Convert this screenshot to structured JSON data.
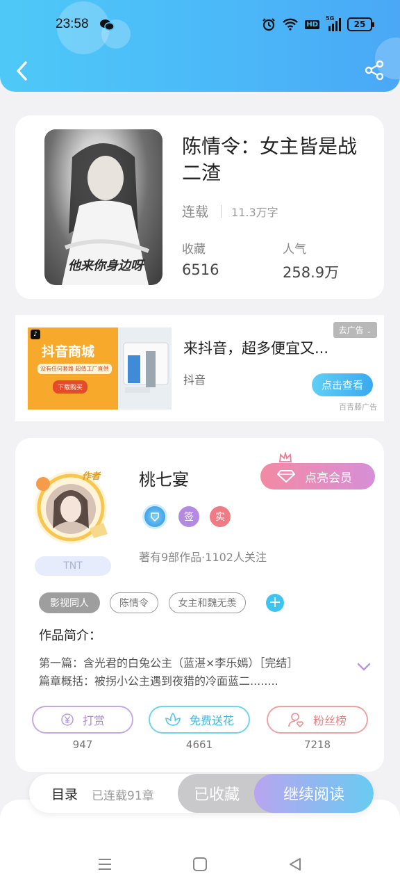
{
  "status_bar": {
    "time": "23:58",
    "network": "5G",
    "hd": "HD",
    "battery": "25"
  },
  "book": {
    "title": "陈情令：女主皆是战二渣",
    "status": "连载",
    "words": "11.3万字",
    "favorites_label": "收藏",
    "favorites_value": "6516",
    "popularity_label": "人气",
    "popularity_value": "258.9万",
    "cover_text": "他来你身边呀"
  },
  "ad": {
    "image_title": "抖音商城",
    "image_subtitle": "没有任何套路 超值工厂直供",
    "image_cta": "下载购买",
    "title": "来抖音，超多便宜又...",
    "source": "抖音",
    "close_label": "去广告",
    "cta_label": "点击查看",
    "provider": "百青藤广告"
  },
  "author": {
    "name": "桃七宴",
    "avatar_badge": "作者",
    "vip_label": "点亮会员",
    "badge_sign": "签",
    "badge_real": "实",
    "stats": "著有9部作品·1102人关注",
    "fan_tag": "TNT"
  },
  "tags": [
    "影视同人",
    "陈情令",
    "女主和魏无羡"
  ],
  "intro": {
    "label": "作品简介：",
    "line1": "第一篇：含光君的白兔公主（蓝湛×李乐嫣）［完结］",
    "line2": "篇章概括：被拐小公主遇到夜猎的冷面蓝二........"
  },
  "actions": [
    {
      "label": "打赏",
      "count": "947",
      "color": "#b48ee0"
    },
    {
      "label": "免费送花",
      "count": "4661",
      "color": "#42c6e8"
    },
    {
      "label": "粉丝榜",
      "count": "7218",
      "color": "#ea8585"
    }
  ],
  "bottom_bar": {
    "catalog": "目录",
    "progress": "已连载91章",
    "saved": "已收藏",
    "read": "继续阅读"
  }
}
